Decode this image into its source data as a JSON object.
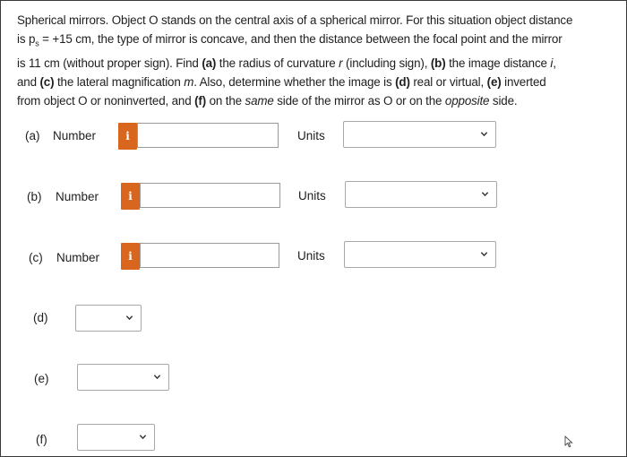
{
  "problem": {
    "line1": "Spherical mirrors. Object O stands on the central axis of a spherical mirror. For this situation object distance",
    "line2_pre": "is p",
    "line2_sub": "s",
    "line2_post": " = +15 cm, the type of mirror is concave, and then the distance between the focal point and the mirror",
    "line3_pre": "is 11 cm (without proper sign). Find ",
    "line3_a": "(a)",
    "line3_mid1": " the radius of curvature ",
    "line3_r": "r",
    "line3_mid2": " (including sign), ",
    "line3_b": "(b)",
    "line3_mid3": " the image distance ",
    "line3_i": "i",
    "line3_end": ",",
    "line4_pre": "and ",
    "line4_c": "(c)",
    "line4_mid1": " the lateral magnification ",
    "line4_m": "m",
    "line4_mid2": ". Also, determine whether the image is ",
    "line4_d": "(d)",
    "line4_mid3": " real or virtual, ",
    "line4_e": "(e)",
    "line4_end": " inverted",
    "line5_pre": "from object O or noninverted, and ",
    "line5_f": "(f)",
    "line5_mid1": " on the ",
    "line5_same": "same",
    "line5_mid2": " side of the mirror as O or on the ",
    "line5_opposite": "opposite",
    "line5_end": " side."
  },
  "rows": {
    "a": {
      "label": "(a)",
      "number_label": "Number",
      "info": "i",
      "value": "",
      "units_label": "Units",
      "units_value": ""
    },
    "b": {
      "label": "(b)",
      "number_label": "Number",
      "info": "i",
      "value": "",
      "units_label": "Units",
      "units_value": ""
    },
    "c": {
      "label": "(c)",
      "number_label": "Number",
      "info": "i",
      "value": "",
      "units_label": "Units",
      "units_value": ""
    },
    "d": {
      "label": "(d)",
      "select_value": ""
    },
    "e": {
      "label": "(e)",
      "select_value": ""
    },
    "f": {
      "label": "(f)",
      "select_value": ""
    }
  },
  "colors": {
    "info_button": "#d9661f",
    "text": "#1e1e1e",
    "border": "#9a9a9a"
  },
  "icons": {
    "info": "info-icon",
    "dropdown": "chevron-down-icon",
    "cursor": "mouse-cursor-icon"
  }
}
